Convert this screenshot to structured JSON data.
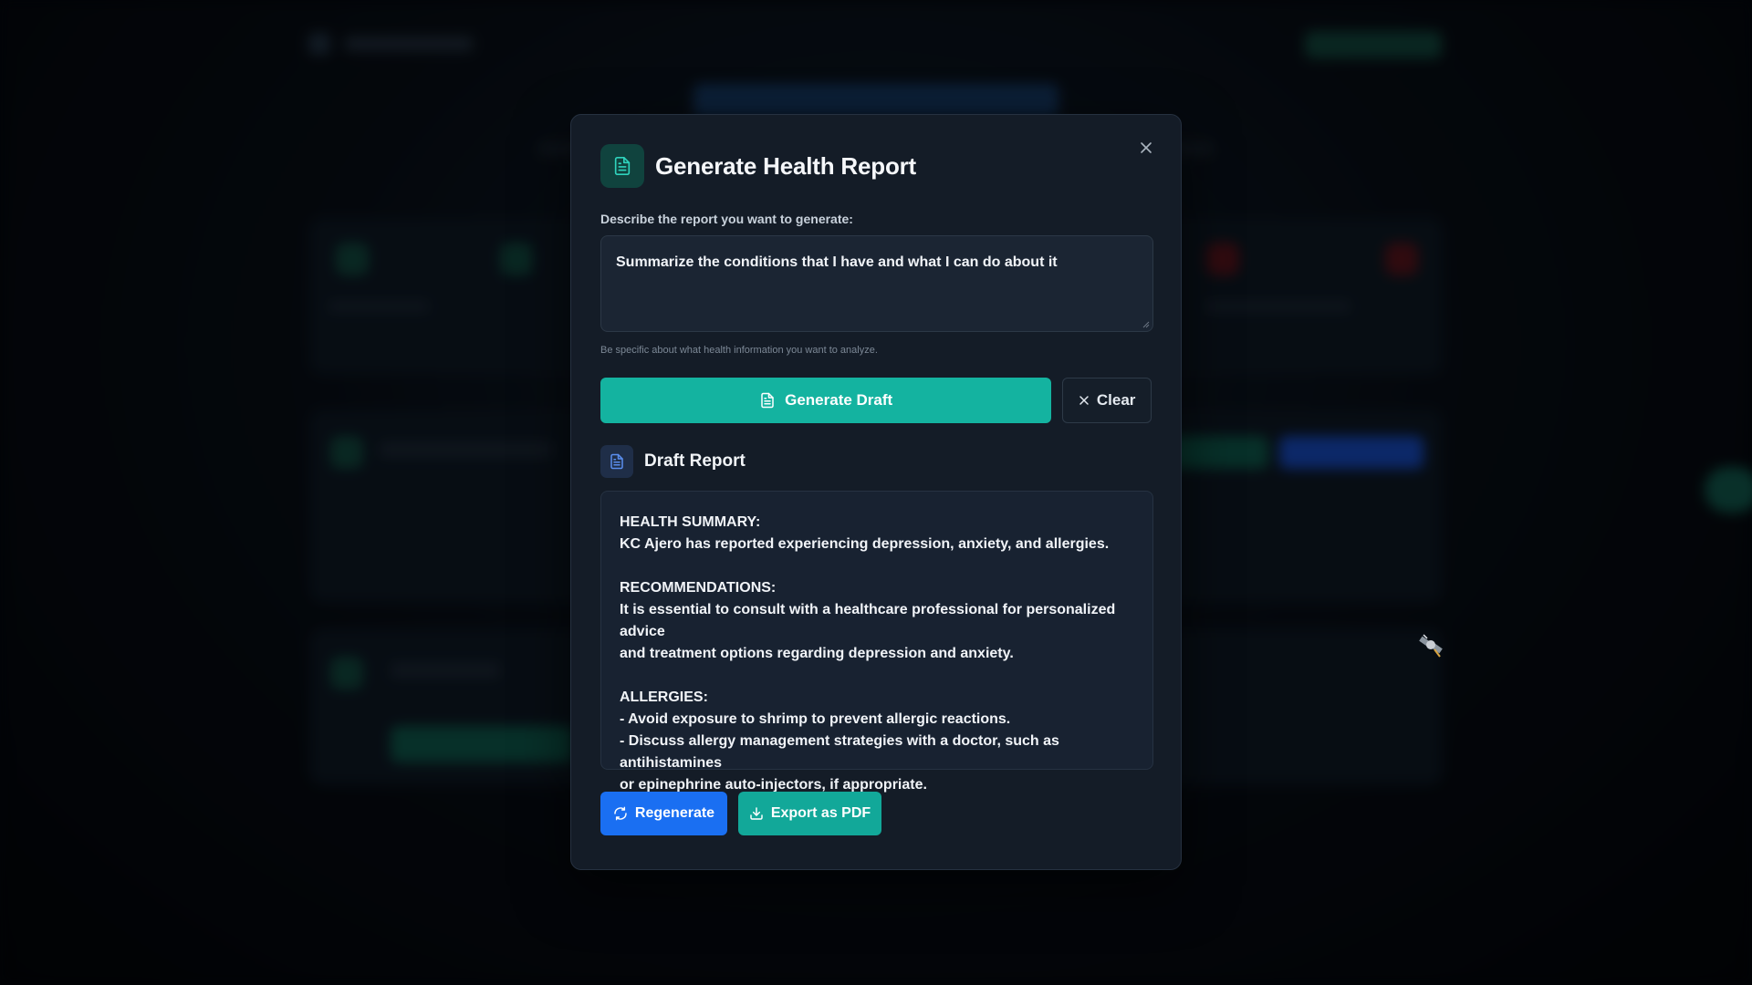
{
  "modal": {
    "title": "Generate Health Report",
    "icon": "document-icon",
    "prompt_label": "Describe the report you want to generate:",
    "prompt_value": "Summarize the conditions that I have and what I can do about it",
    "hint": "Be specific about what health information you want to analyze.",
    "generate_label": "Generate Draft",
    "clear_label": "Clear"
  },
  "draft": {
    "title": "Draft Report",
    "lines": [
      "HEALTH SUMMARY:",
      "KC Ajero has reported experiencing depression, anxiety, and allergies.",
      "",
      "RECOMMENDATIONS:",
      "It is essential to consult with a healthcare professional for personalized advice",
      "and treatment options regarding depression and anxiety.",
      "",
      "ALLERGIES:",
      "- Avoid exposure to shrimp to prevent allergic reactions.",
      "- Discuss allergy management strategies with a doctor, such as antihistamines",
      "or epinephrine auto-injectors, if appropriate."
    ]
  },
  "actions": {
    "regenerate_label": "Regenerate",
    "export_label": "Export as PDF"
  },
  "colors": {
    "accent_teal": "#14b3a0",
    "accent_blue": "#1a6ff2",
    "modal_bg": "#141c27"
  }
}
